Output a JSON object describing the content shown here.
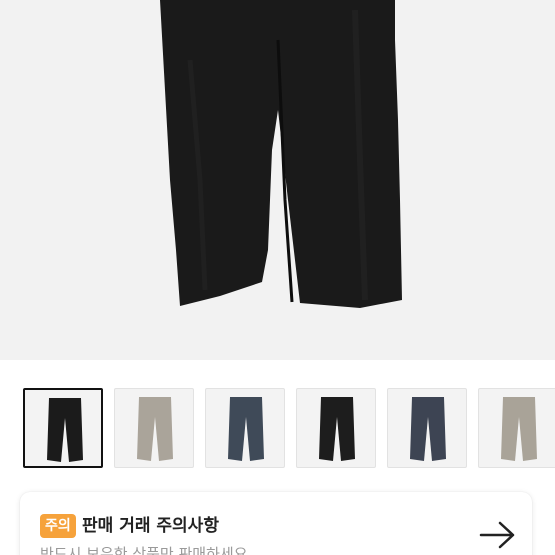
{
  "product": {
    "main_image": "black-pants-photo",
    "thumbnails": [
      {
        "color_name": "black",
        "color": "#1b1b1b",
        "selected": true
      },
      {
        "color_name": "beige",
        "color": "#aaa49a",
        "selected": false
      },
      {
        "color_name": "navy",
        "color": "#3f4a58",
        "selected": false
      },
      {
        "color_name": "black",
        "color": "#1d1d1d",
        "selected": false
      },
      {
        "color_name": "navy",
        "color": "#3d4453",
        "selected": false
      },
      {
        "color_name": "beige",
        "color": "#a9a398",
        "selected": false
      }
    ]
  },
  "notice": {
    "badge": "주의",
    "title": "판매 거래 주의사항",
    "subtitle": "반드시 보유한 상품만 판매하세요",
    "arrow_icon": "arrow-right-icon"
  },
  "colors": {
    "badge_bg": "#f6a23b",
    "page_bg": "#ffffff",
    "hero_bg": "#f2f2f2"
  }
}
